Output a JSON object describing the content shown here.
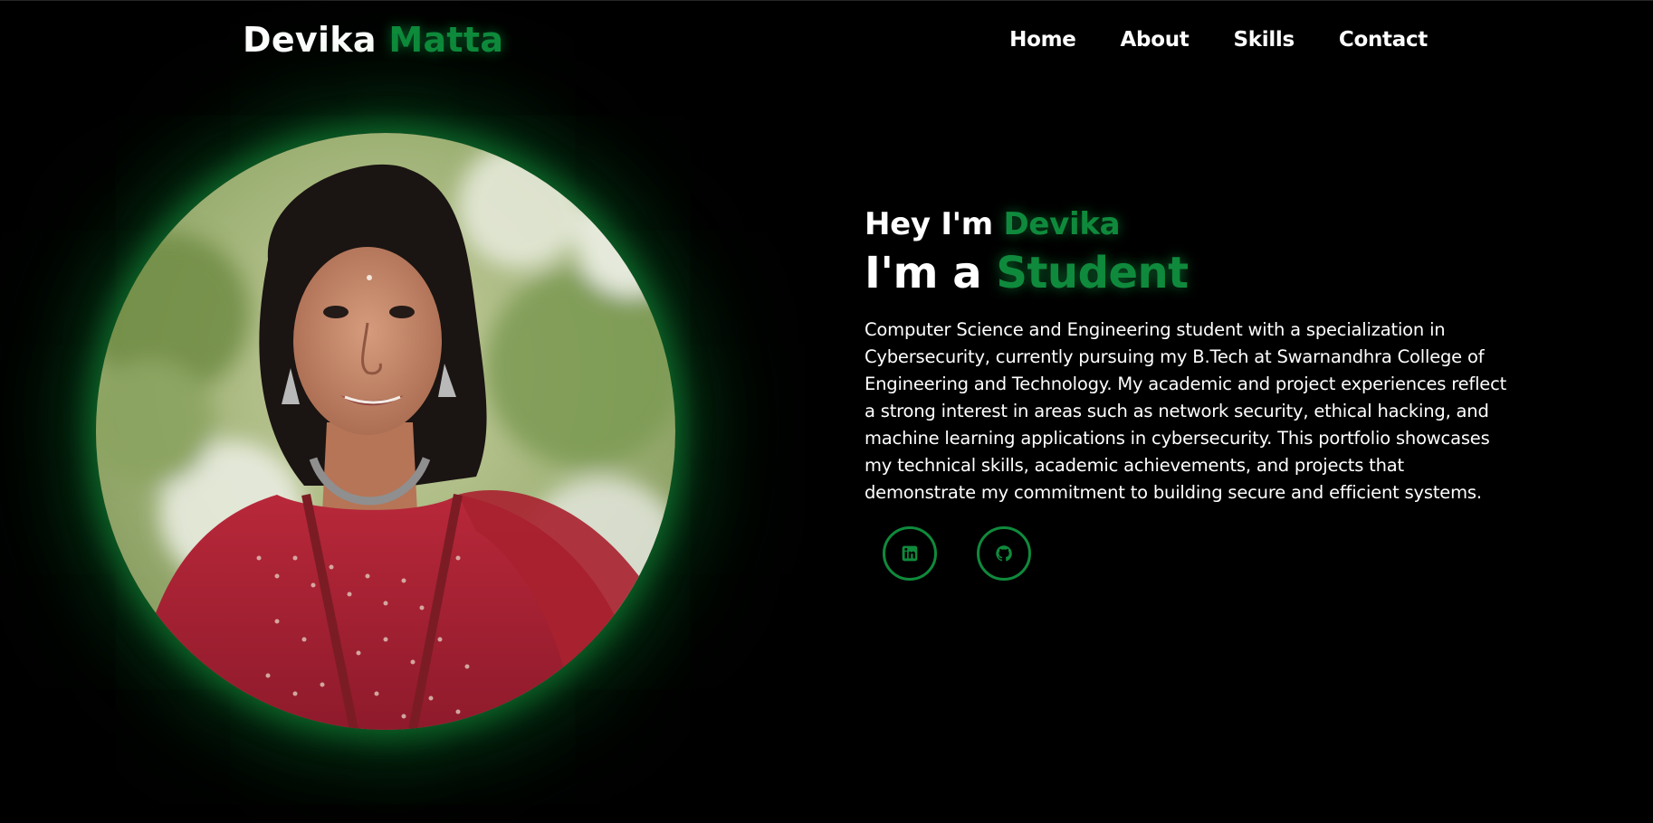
{
  "header": {
    "logo_first": "Devika",
    "logo_last": "Matta",
    "nav": [
      {
        "label": "Home"
      },
      {
        "label": "About"
      },
      {
        "label": "Skills"
      },
      {
        "label": "Contact"
      }
    ]
  },
  "hero": {
    "greeting_prefix": "Hey I'm",
    "greeting_name": "Devika",
    "role_prefix": "I'm a",
    "role_word": "Student",
    "bio": "Computer Science and Engineering student with a specialization in Cybersecurity, currently pursuing my B.Tech at Swarnandhra College of Engineering and Technology. My academic and project experiences reflect a strong interest in areas such as network security, ethical hacking, and machine learning applications in cybersecurity. This portfolio showcases my technical skills, academic achievements, and projects that demonstrate my commitment to building secure and efficient systems."
  },
  "socials": [
    {
      "icon": "linkedin-icon"
    },
    {
      "icon": "github-icon"
    }
  ],
  "colors": {
    "background": "#000000",
    "accent": "#0f8a3c",
    "text": "#ffffff"
  }
}
